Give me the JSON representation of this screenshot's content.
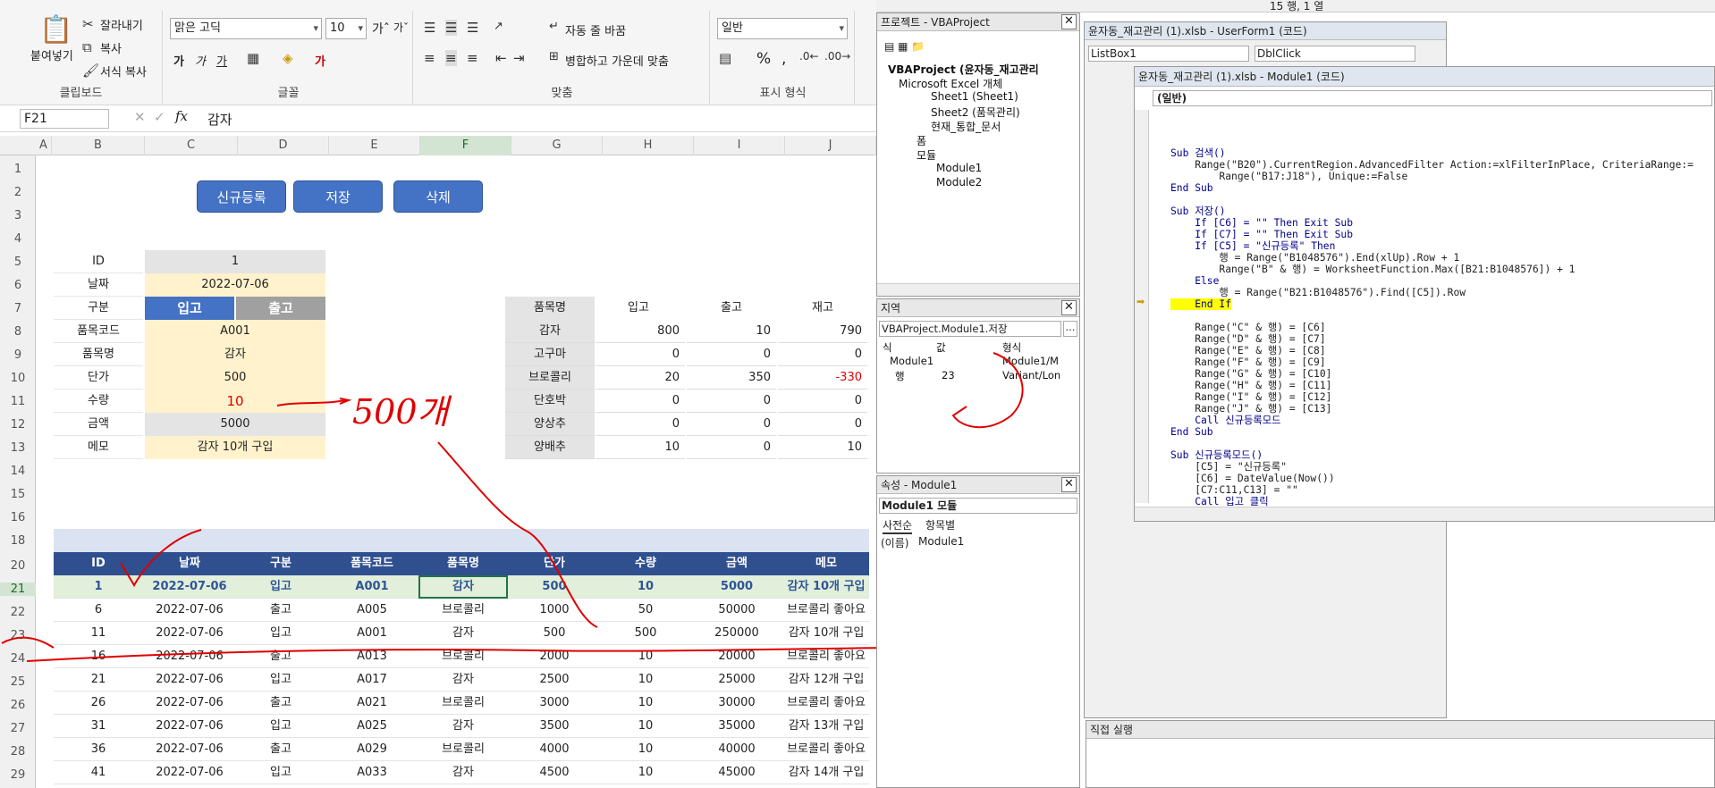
{
  "ribbon": {
    "clipboard": {
      "paste": "붙여넣기",
      "cut": "잘라내기",
      "copy": "복사",
      "format_painter": "서식 복사",
      "label": "클립보드"
    },
    "font": {
      "name": "맑은 고딕",
      "size": "10",
      "label": "글꼴"
    },
    "alignment": {
      "wrap": "자동 줄 바꿈",
      "merge": "병합하고 가운데 맞춤",
      "label": "맞춤"
    },
    "number": {
      "format": "일반",
      "label": "표시 형식"
    }
  },
  "formula_bar": {
    "name_box": "F21",
    "formula": "감자"
  },
  "sheet": {
    "columns": [
      "A",
      "B",
      "C",
      "D",
      "E",
      "F",
      "G",
      "H",
      "I",
      "J"
    ],
    "rows": [
      "1",
      "2",
      "3",
      "4",
      "5",
      "6",
      "7",
      "8",
      "9",
      "10",
      "11",
      "12",
      "13",
      "14",
      "15",
      "16",
      "18",
      "20",
      "21",
      "22",
      "23",
      "24",
      "25",
      "26",
      "27",
      "28",
      "29"
    ],
    "buttons": {
      "new": "신규등록",
      "save": "저장",
      "delete": "삭제"
    },
    "form": {
      "labels": [
        "ID",
        "날짜",
        "구분",
        "품목코드",
        "품목명",
        "단가",
        "수량",
        "금액",
        "메모"
      ],
      "id": "1",
      "date": "2022-07-06",
      "in_label": "입고",
      "out_label": "출고",
      "code": "A001",
      "name": "감자",
      "price": "500",
      "qty": "10",
      "amount": "5000",
      "memo": "감자 10개 구입"
    },
    "stock": {
      "headers": [
        "품목명",
        "입고",
        "출고",
        "재고"
      ],
      "rows": [
        [
          "감자",
          "800",
          "10",
          "790"
        ],
        [
          "고구마",
          "0",
          "0",
          "0"
        ],
        [
          "브로콜리",
          "20",
          "350",
          "-330"
        ],
        [
          "단호박",
          "0",
          "0",
          "0"
        ],
        [
          "양상추",
          "0",
          "0",
          "0"
        ],
        [
          "양배추",
          "10",
          "0",
          "10"
        ]
      ]
    },
    "table": {
      "headers": [
        "ID",
        "날짜",
        "구분",
        "품목코드",
        "품목명",
        "단가",
        "수량",
        "금액",
        "메모"
      ],
      "rows": [
        [
          "1",
          "2022-07-06",
          "입고",
          "A001",
          "감자",
          "500",
          "10",
          "5000",
          "감자 10개 구입"
        ],
        [
          "6",
          "2022-07-06",
          "출고",
          "A005",
          "브로콜리",
          "1000",
          "50",
          "50000",
          "브로콜리 좋아요"
        ],
        [
          "11",
          "2022-07-06",
          "입고",
          "A001",
          "감자",
          "500",
          "500",
          "250000",
          "감자 10개 구입"
        ],
        [
          "16",
          "2022-07-06",
          "출고",
          "A013",
          "브로콜리",
          "2000",
          "10",
          "20000",
          "브로콜리 좋아요"
        ],
        [
          "21",
          "2022-07-06",
          "입고",
          "A017",
          "감자",
          "2500",
          "10",
          "25000",
          "감자 12개 구입"
        ],
        [
          "26",
          "2022-07-06",
          "출고",
          "A021",
          "브로콜리",
          "3000",
          "10",
          "30000",
          "브로콜리 좋아요"
        ],
        [
          "31",
          "2022-07-06",
          "입고",
          "A025",
          "감자",
          "3500",
          "10",
          "35000",
          "감자 13개 구입"
        ],
        [
          "36",
          "2022-07-06",
          "출고",
          "A029",
          "브로콜리",
          "4000",
          "10",
          "40000",
          "브로콜리 좋아요"
        ],
        [
          "41",
          "2022-07-06",
          "입고",
          "A033",
          "감자",
          "4500",
          "10",
          "45000",
          "감자 14개 구입"
        ]
      ]
    },
    "annotation": "500개"
  },
  "vbe": {
    "toolbar_status": "15 행, 1 열",
    "project": {
      "title": "프로젝트 - VBAProject",
      "root": "VBAProject (윤자동_재고관리",
      "excel_objects": "Microsoft Excel 개체",
      "sheet1": "Sheet1 (Sheet1)",
      "sheet2": "Sheet2 (품목관리)",
      "workbook": "현재_통합_문서",
      "forms": "폼",
      "modules": "모듈",
      "module1": "Module1",
      "module2": "Module2"
    },
    "locals": {
      "title": "지역",
      "context": "VBAProject.Module1.저장",
      "headers": [
        "식",
        "값",
        "형식"
      ],
      "rows": [
        [
          "Module1",
          "",
          "Module1/M"
        ],
        [
          "행",
          "23",
          "Variant/Lon"
        ]
      ]
    },
    "properties": {
      "title": "속성 - Module1",
      "object": "Module1 모듈",
      "tab_alpha": "사전순",
      "tab_cat": "항목별",
      "prop_name": "(이름)",
      "prop_value": "Module1"
    },
    "userform_window": {
      "title": "윤자동_재고관리 (1).xlsb - UserForm1 (코드)",
      "object": "ListBox1",
      "proc": "DblClick"
    },
    "module_window": {
      "title": "윤자동_재고관리 (1).xlsb - Module1 (코드)",
      "general": "(일반)",
      "code": [
        "Sub 검색()",
        "    Range(\"B20\").CurrentRegion.AdvancedFilter Action:=xlFilterInPlace, CriteriaRange:=",
        "        Range(\"B17:J18\"), Unique:=False",
        "End Sub",
        "",
        "Sub 저장()",
        "    If [C6] = \"\" Then Exit Sub",
        "    If [C7] = \"\" Then Exit Sub",
        "    If [C5] = \"신규등록\" Then",
        "        행 = Range(\"B1048576\").End(xlUp).Row + 1",
        "        Range(\"B\" & 행) = WorksheetFunction.Max([B21:B1048576]) + 1",
        "    Else",
        "        행 = Range(\"B21:B1048576\").Find([C5]).Row",
        "    End If",
        "",
        "    Range(\"C\" & 행) = [C6]",
        "    Range(\"D\" & 행) = [C7]",
        "    Range(\"E\" & 행) = [C8]",
        "    Range(\"F\" & 행) = [C9]",
        "    Range(\"G\" & 행) = [C10]",
        "    Range(\"H\" & 행) = [C11]",
        "    Range(\"I\" & 행) = [C12]",
        "    Range(\"J\" & 행) = [C13]",
        "    Call 신규등록모드",
        "End Sub",
        "",
        "Sub 신규등록모드()",
        "    [C5] = \"신규등록\"",
        "    [C6] = DateValue(Now())",
        "    [C7:C11,C13] = \"\"",
        "    Call 입고_클릭",
        "End Sub"
      ]
    },
    "immediate": {
      "title": "직접 실행"
    }
  },
  "colors": {
    "accent_blue": "#4472c4",
    "header_navy": "#2f4f8f",
    "yellow_fill": "#fff2cc",
    "ink_red": "#e00000"
  }
}
